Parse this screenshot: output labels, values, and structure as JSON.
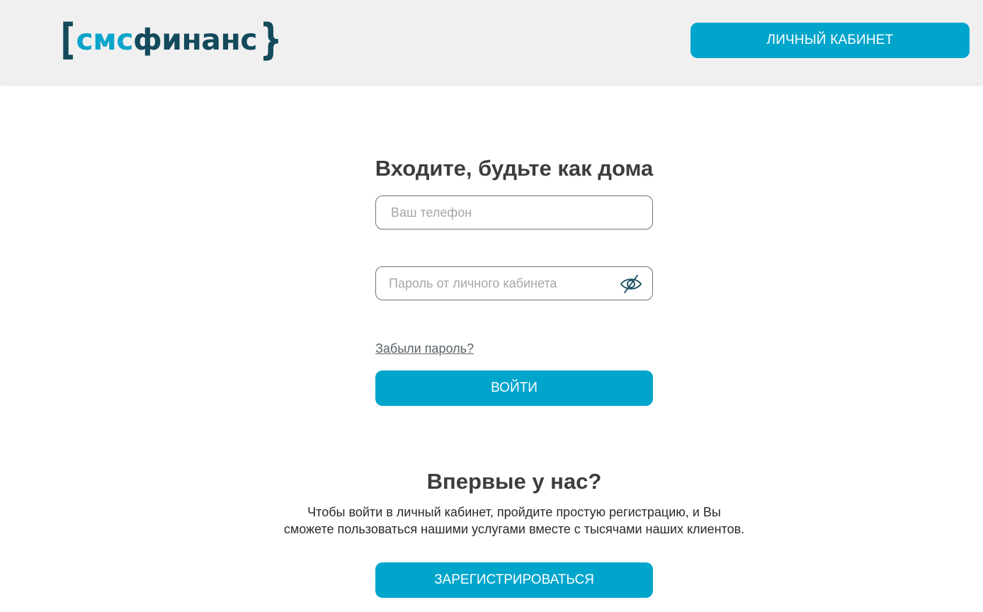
{
  "header": {
    "logo_sms": "смс",
    "logo_finance": "финанс",
    "cabinet_button": "ЛИЧНЫЙ КАБИНЕТ"
  },
  "login": {
    "title": "Входите, будьте как дома",
    "phone_placeholder": "Ваш телефон",
    "password_placeholder": "Пароль от личного кабинета",
    "password_toggle_icon": "eye-slash-icon",
    "forgot_link": "Забыли пароль?",
    "submit_button": "ВОЙТИ"
  },
  "register": {
    "title": "Впервые у нас?",
    "description_line1": "Чтобы войти в личный кабинет, пройдите простую регистрацию, и Вы",
    "description_line2": "сможете пользоваться нашими услугами вместе с тысячами наших клиентов.",
    "button": "ЗАРЕГИСТРИРОВАТЬСЯ"
  },
  "colors": {
    "accent": "#00a5cc",
    "brand_dark": "#134a5c",
    "brand_light": "#0aa4cc",
    "header_bg": "#f0f0f0",
    "heading_text": "#3d3d3d"
  }
}
